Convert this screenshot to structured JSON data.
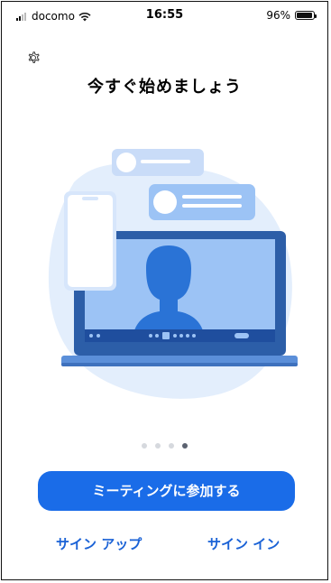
{
  "status_bar": {
    "carrier": "docomo",
    "time": "16:55",
    "battery_percent": "96%",
    "battery_level": 0.96
  },
  "settings_icon": "gear-icon",
  "main": {
    "title": "今すぐ始めましょう",
    "carousel": {
      "total": 4,
      "active_index": 3
    },
    "join_meeting_label": "ミーティングに参加する",
    "sign_up_label": "サイン アップ",
    "sign_in_label": "サイン イン"
  },
  "colors": {
    "accent": "#1A6CE8",
    "link": "#1A62D6",
    "illustration_blob": "#E3EEFC",
    "illustration_mid": "#9CC3F5",
    "illustration_dark": "#1F4E9E"
  }
}
